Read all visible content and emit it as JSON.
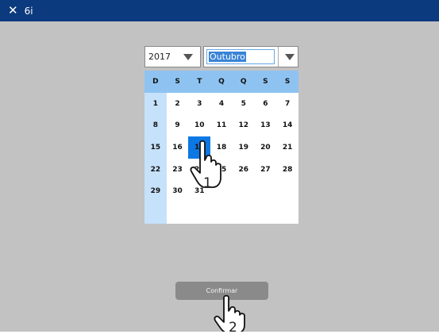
{
  "window": {
    "title": "6i",
    "close_icon": "close-icon"
  },
  "year_select": {
    "value": "2017"
  },
  "month_select": {
    "value": "Outubro"
  },
  "calendar": {
    "weekday_headers": [
      "D",
      "S",
      "T",
      "Q",
      "Q",
      "S",
      "S"
    ],
    "weeks": [
      [
        "1",
        "2",
        "3",
        "4",
        "5",
        "6",
        "7"
      ],
      [
        "8",
        "9",
        "10",
        "11",
        "12",
        "13",
        "14"
      ],
      [
        "15",
        "16",
        "17",
        "18",
        "19",
        "20",
        "21"
      ],
      [
        "22",
        "23",
        "24",
        "25",
        "26",
        "27",
        "28"
      ],
      [
        "29",
        "30",
        "31",
        "",
        "",
        "",
        ""
      ]
    ],
    "selected_day": "17",
    "colors": {
      "header": "#8ec3f1",
      "sunday_column": "#c6e1fa",
      "selected": "#0b78e3"
    }
  },
  "confirm_button": {
    "label": "Confirmar"
  },
  "annotations": [
    {
      "label": "1",
      "icon": "hand-pointer-icon"
    },
    {
      "label": "2",
      "icon": "hand-pointer-icon"
    }
  ],
  "colors": {
    "titlebar": "#0b3a7e",
    "background": "#c2c2c2"
  }
}
